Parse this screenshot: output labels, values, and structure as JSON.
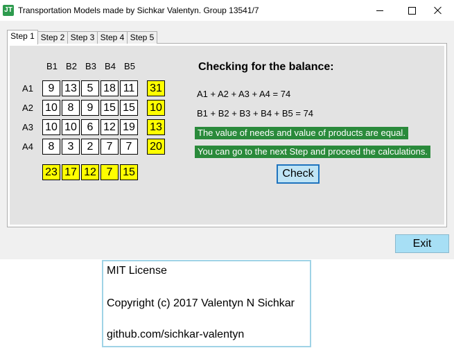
{
  "window": {
    "title": "Transportation Models made by Sichkar Valentyn. Group 13541/7",
    "icon_label": "JT"
  },
  "tabs": [
    {
      "label": "Step 1",
      "active": true
    },
    {
      "label": "Step 2"
    },
    {
      "label": "Step 3"
    },
    {
      "label": "Step 4"
    },
    {
      "label": "Step 5"
    }
  ],
  "matrix": {
    "columns": [
      "B1",
      "B2",
      "B3",
      "B4",
      "B5"
    ],
    "rows": [
      "A1",
      "A2",
      "A3",
      "A4"
    ],
    "costs": [
      [
        "9",
        "13",
        "5",
        "18",
        "11"
      ],
      [
        "10",
        "8",
        "9",
        "15",
        "15"
      ],
      [
        "10",
        "10",
        "6",
        "12",
        "19"
      ],
      [
        "8",
        "3",
        "2",
        "7",
        "7"
      ]
    ],
    "supplies": [
      "31",
      "10",
      "13",
      "20"
    ],
    "demands": [
      "23",
      "17",
      "12",
      "7",
      "15"
    ]
  },
  "balance": {
    "heading": "Checking for the balance:",
    "sum_a": "A1 + A2 + A3 + A4 =  74",
    "sum_b": "B1 + B2 + B3 + B4 + B5 =  74",
    "message_equal": "The value of needs and value of products are equal.",
    "message_next": "You can go to the next Step and proceed the calculations.",
    "check_label": "Check",
    "message_bg": "#2a8a3b"
  },
  "exit_label": "Exit",
  "license": {
    "line1": "MIT License",
    "line2": "Copyright (c) 2017 Valentyn N Sichkar",
    "line3": "github.com/sichkar-valentyn"
  },
  "colors": {
    "highlight": "#ffff00",
    "button": "#a7dff5"
  }
}
